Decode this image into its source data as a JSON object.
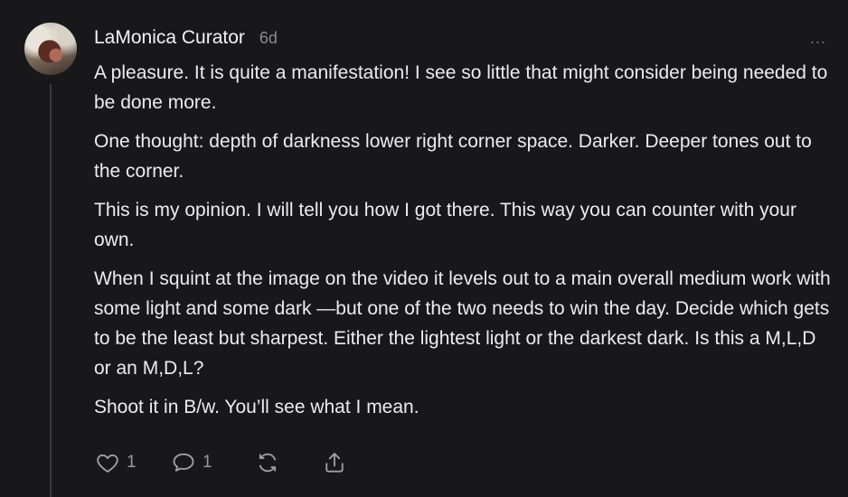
{
  "comment": {
    "author": "LaMonica Curator",
    "time": "6d",
    "more_label": "...",
    "paragraphs": [
      "A pleasure. It is quite a manifestation! I see so little that might consider being needed to be done more.",
      "One thought: depth of darkness lower right corner space. Darker. Deeper tones out to the corner.",
      "This is my opinion. I will tell you how I got there. This way you can counter with your own.",
      "When I squint at the image on the video it levels out to a main overall medium work with some light and some dark —but one of the two needs to win the day. Decide which gets to be the least but sharpest. Either the lightest light or the darkest dark. Is this a M,L,D or an M,D,L?",
      "Shoot it in B/w. You’ll see what I mean."
    ]
  },
  "actions": {
    "like_count": "1",
    "reply_count": "1",
    "icons": [
      "heart-icon",
      "comment-icon",
      "restack-icon",
      "share-icon"
    ]
  },
  "colors": {
    "background": "#18181a",
    "text": "#ececec",
    "muted": "#8c8c90",
    "thread_line": "#3a3a3e"
  }
}
